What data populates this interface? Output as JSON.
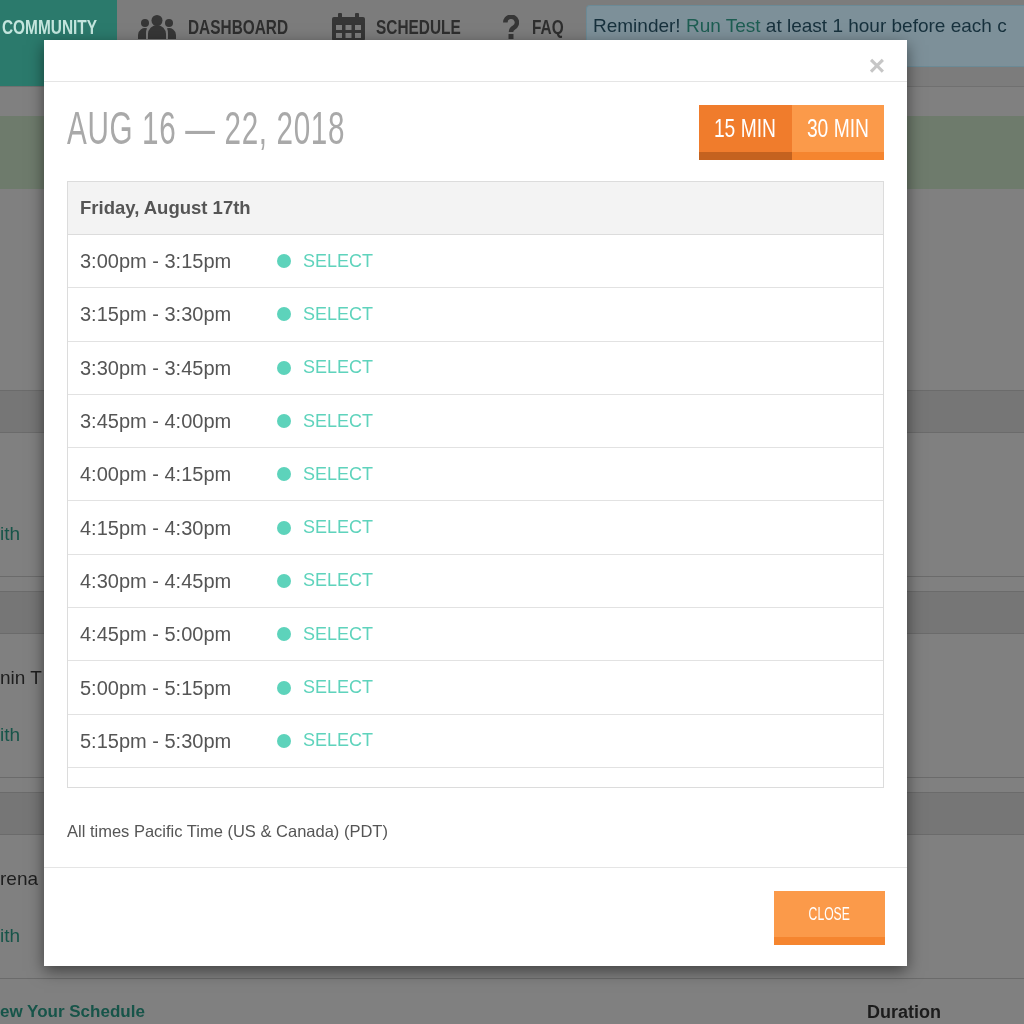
{
  "page": {
    "brand": "COMMUNITY",
    "nav": [
      "DASHBOARD",
      "SCHEDULE",
      "FAQ"
    ],
    "reminder": {
      "lead": "Reminder!",
      "link": "Run Test",
      "rest": "at least 1 hour before each c"
    },
    "sections": [
      {
        "lines": [
          {
            "kind": "link",
            "text": "ith"
          }
        ]
      },
      {
        "lines": [
          {
            "kind": "text",
            "text": "nin T"
          },
          {
            "kind": "link",
            "text": "ith"
          }
        ]
      },
      {
        "lines": [
          {
            "kind": "text",
            "text": "rena"
          },
          {
            "kind": "link",
            "text": "ith"
          }
        ]
      }
    ],
    "footer": {
      "link": "ew Your Schedule",
      "column_heading": "Duration"
    }
  },
  "modal": {
    "close_icon": "×",
    "title": "AUG 16 — 22, 2018",
    "durations": [
      {
        "label": "15 MIN",
        "selected": true
      },
      {
        "label": "30 MIN",
        "selected": false
      }
    ],
    "table": {
      "heading": "Friday, August 17th",
      "rows": [
        {
          "time": "3:00pm - 3:15pm",
          "action": "SELECT"
        },
        {
          "time": "3:15pm - 3:30pm",
          "action": "SELECT"
        },
        {
          "time": "3:30pm - 3:45pm",
          "action": "SELECT"
        },
        {
          "time": "3:45pm - 4:00pm",
          "action": "SELECT"
        },
        {
          "time": "4:00pm - 4:15pm",
          "action": "SELECT"
        },
        {
          "time": "4:15pm - 4:30pm",
          "action": "SELECT"
        },
        {
          "time": "4:30pm - 4:45pm",
          "action": "SELECT"
        },
        {
          "time": "4:45pm - 5:00pm",
          "action": "SELECT"
        },
        {
          "time": "5:00pm - 5:15pm",
          "action": "SELECT"
        },
        {
          "time": "5:15pm - 5:30pm",
          "action": "SELECT"
        }
      ]
    },
    "note": "All times Pacific Time (US & Canada) (PDT)",
    "close_button": "CLOSE"
  }
}
